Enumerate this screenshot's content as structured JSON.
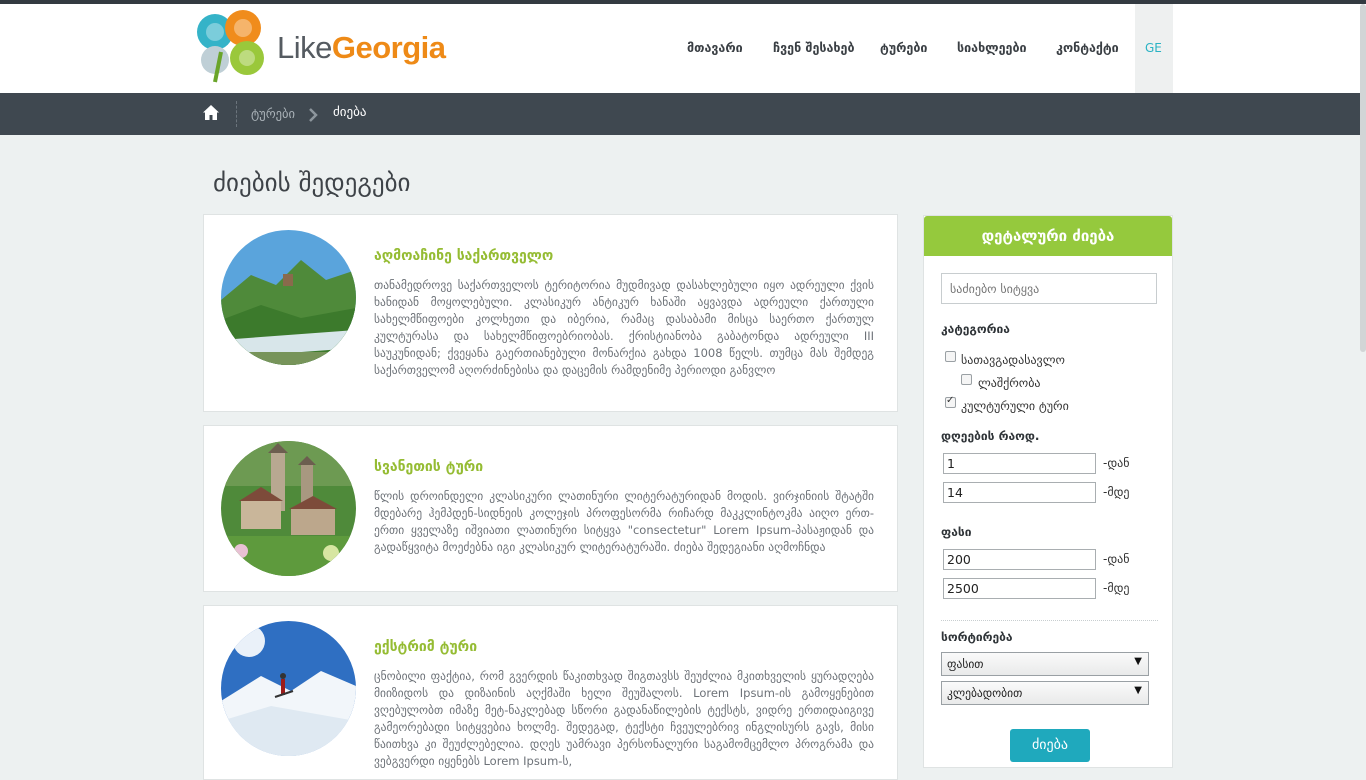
{
  "brand": {
    "like": "Like",
    "georgia": "Georgia"
  },
  "nav": {
    "items": [
      {
        "label": "მთავარი"
      },
      {
        "label": "ჩვენ შესახებ"
      },
      {
        "label": "ტურები"
      },
      {
        "label": "სიახლეები"
      },
      {
        "label": "კონტაქტი"
      }
    ],
    "lang": "GE"
  },
  "breadcrumb": {
    "tours": "ტურები",
    "current": "ძიება"
  },
  "page_title": "ძიების შედეგები",
  "results": [
    {
      "title": "აღმოაჩინე საქართველო",
      "text": "თანამედროვე საქართველოს ტერიტორია მუდმივად დასახლებული იყო ადრეული ქვის ხანიდან მოყოლებული. კლასიკურ ანტიკურ ხანაში აყვავდა ადრეული ქართული სახელმწიფოები კოლხეთი და იბერია, რამაც დასაბამი მისცა საერთო ქართულ კულტურასა და სახელმწიფოებრიობას. ქრისტიანობა გაბატონდა ადრეული III საუკუნიდან; ქვეყანა გაერთიანებული მონარქია გახდა 1008 წელს. თუმცა მას შემდეგ საქართველომ აღორძინებისა და დაცემის რამდენიმე პერიოდი განვლო"
    },
    {
      "title": "სვანეთის ტური",
      "text": "წლის დროინდელი კლასიკური ლათინური ლიტერატურიდან მოდის. ვირჯინიის შტატში მდებარე ჰემპდენ-სიდნეის კოლეჯის პროფესორმა რიჩარდ მაკკლინტოკმა აიღო ერთ-ერთი ყველაზე იშვიათი ლათინური სიტყვა \"consectetur\" Lorem Ipsum-პასაჟიდან და გადაწყვიტა მოეძებნა იგი კლასიკურ ლიტერატურაში. ძიება შედეგიანი აღმოჩნდა"
    },
    {
      "title": "ექსტრიმ ტური",
      "text": "ცნობილი ფაქტია, რომ გვერდის წაკითხვად შიგთავსს შეუძლია მკითხველის ყურადღება მიიზიდოს და დიზაინის აღქმაში ხელი შეუშალოს. Lorem Ipsum-ის გამოყენებით ვღებულობთ იმაზე მეტ-ნაკლებად სწორი გადანაწილების ტექსტს, ვიდრე ერთიდაიგივე გამეორებადი სიტყვებია ხოლმე. შედეგად, ტექსტი ჩვეულებრივ ინგლისურს გავს, მისი წაითხვა კი შეუძლებელია. დღეს უამრავი პერსონალური საგამომცემლო პროგრამა და ვებგვერდი იყენებს Lorem Ipsum-ს,"
    }
  ],
  "sidebar": {
    "heading": "დეტალური ძიება",
    "search_placeholder": "საძიებო სიტყვა",
    "category_label": "კატეგორია",
    "categories": [
      {
        "label": "სათავგადასავლო",
        "checked": false
      },
      {
        "label": "ლაშქრობა",
        "checked": false
      },
      {
        "label": "კულტურული ტური",
        "checked": true
      }
    ],
    "days_label": "დღეების რაოდ.",
    "days_from": "1",
    "days_to": "14",
    "price_label": "ფასი",
    "price_from": "200",
    "price_to": "2500",
    "from_suffix": "-დან",
    "to_suffix": "-მდე",
    "sort_label": "სორტირება",
    "sort_by": "ფასით",
    "sort_order": "კლებადობით",
    "search_button": "ძიება"
  },
  "colors": {
    "accent_green": "#95c93d",
    "accent_teal": "#1fa9bd",
    "breadcrumb_bg": "#3f4850",
    "brand_orange": "#ee8a17"
  }
}
